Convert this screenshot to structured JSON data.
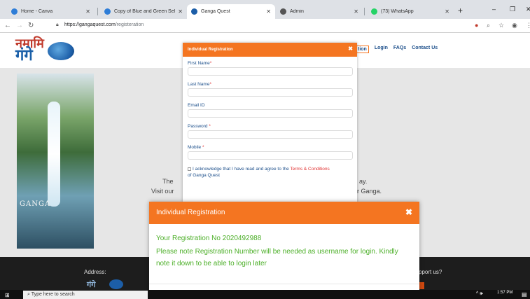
{
  "browser": {
    "tabs": [
      {
        "title": "Home - Canva",
        "favicon_color": "#2e7dd7"
      },
      {
        "title": "Copy of Blue and Green Self-C",
        "favicon_color": "#2e7dd7"
      },
      {
        "title": "Ganga Quest",
        "favicon_color": "#1c5ea8"
      },
      {
        "title": "Admin",
        "favicon_color": "#555555"
      },
      {
        "title": "(73) WhatsApp",
        "favicon_color": "#25d366"
      }
    ],
    "url_host": "https://gangaquest.com",
    "url_path": "/registeration",
    "new_tab": "+"
  },
  "site": {
    "logo_line1": "नमामि",
    "logo_line2": "गंगे",
    "menu": [
      {
        "label": "tion",
        "boxed": true
      },
      {
        "label": "Login"
      },
      {
        "label": "FAQs"
      },
      {
        "label": "Contact Us"
      }
    ],
    "hero_label": "GANGA",
    "bg_text_1": "The",
    "bg_text_2": "Visit our",
    "bg_text_3": "ay.",
    "bg_text_4": "r Ganga.",
    "footer_address": "Address:",
    "footer_support": "pport us?",
    "footer_logo": "गंगे"
  },
  "form_modal": {
    "title": "Individual Registration",
    "fields": [
      {
        "label": "First Name",
        "required": "*"
      },
      {
        "label": "Last Name",
        "required": "*"
      },
      {
        "label": "Email ID",
        "required": ""
      },
      {
        "label": "Password ",
        "required": "*"
      },
      {
        "label": "Mobile ",
        "required": "*"
      }
    ],
    "agree_text": "I acknowledge that I have read and agree to the ",
    "agree_link": "Terms & Conditions",
    "agree_tail": "of Ganga Quest"
  },
  "message_modal": {
    "title": "Individual Registration",
    "line1": "Your Registration No 2020492988",
    "line2": "Please note Registration Number will be needed as username for login. Kindly note it down to be able to login later"
  },
  "taskbar": {
    "search_placeholder": "Type here to search",
    "time": "1:57 PM"
  },
  "colors": {
    "accent_orange": "#f47521",
    "success_green": "#4caf28",
    "link_red": "#e03030",
    "brand_blue": "#1b4e8a"
  }
}
